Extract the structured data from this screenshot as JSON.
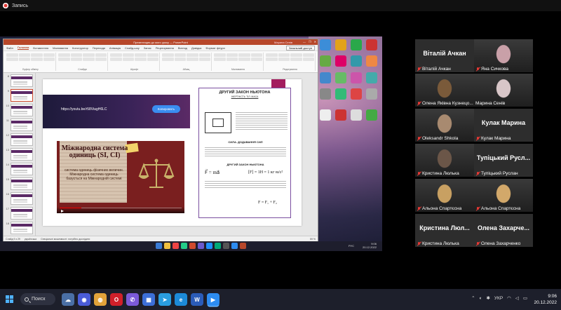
{
  "recording": {
    "label": "Запись",
    "color": "#e53935"
  },
  "powerpoint": {
    "window_title": "Презентация до мого уроку — PowerPoint",
    "user": "Марина Сенів",
    "window_controls": [
      "—",
      "❐",
      "✕"
    ],
    "tabs": [
      "Файл",
      "Головна",
      "Вставлення",
      "Малювання",
      "Конструктор",
      "Переходи",
      "Анімація",
      "Слайд-шоу",
      "Запис",
      "Рецензування",
      "Вигляд",
      "Довідка",
      "Формат фігури"
    ],
    "active_tab": "Головна",
    "share_button": "Загальний доступ",
    "ribbon_groups": [
      "Буфер обміну",
      "Слайди",
      "Шрифт",
      "Абзац",
      "Малювання",
      "Редагування"
    ],
    "slide_numbers": [
      "8",
      "9",
      "10",
      "11",
      "12",
      "13",
      "14",
      "15",
      "16",
      "17",
      "18",
      "19",
      "20"
    ],
    "active_slide": "9",
    "status": {
      "slide": "Слайд 9 з 29",
      "lang": "українська",
      "accessibility": "Спеціальні можливості: потрібно дослідити",
      "zoom": "59 %"
    }
  },
  "slide": {
    "url": "https://youtu.be/r58ViagH6LC",
    "copy_button": "Копировать",
    "video": {
      "title": "Міжнародна система одиниць (SI, СІ)",
      "text": "система одиниць фізичних величин. Міжнародна система одиниць базується на Міжнародній системі",
      "progress": 0.18
    },
    "doc": {
      "title": "ДРУГИЙ ЗАКОН НЬЮТОНА",
      "sub1": "ІНЕРТНІСТЬ ТІЛ. МАСА",
      "sub2": "СИЛА. ДОДАВАННЯ СИЛ",
      "sub3": "ДРУГИЙ ЗАКОН НЬЮТОНА",
      "formula_left": "F⃗ = ma⃗",
      "formula_right": "[F] = 1H = 1 кг·м/с²",
      "formula_bottom": "F = F₁ + F₂"
    }
  },
  "inner_taskbar": {
    "lang": "РУС",
    "time": "9:06",
    "date": "20.12.2022",
    "icon_colors": [
      "#3a7bd5",
      "#f0c040",
      "#e44",
      "#2c8",
      "#d04a2d",
      "#6a5acd",
      "#1e90ff",
      "#0a7",
      "#555",
      "#2d8cf0",
      "#b7472a"
    ]
  },
  "participants": [
    {
      "big_name": "Віталій Ачкан",
      "label": "Віталій Ачкан",
      "muted": true,
      "has_video": false
    },
    {
      "big_name": "",
      "label": "Яна Сичкова",
      "muted": true,
      "has_video": true,
      "face": "#c9a0a8"
    },
    {
      "big_name": "",
      "label": "Олена Яківна Кузнецо...",
      "muted": true,
      "has_video": true,
      "face": "#7a5a3a"
    },
    {
      "big_name": "",
      "label": "Марина Сенів",
      "muted": false,
      "has_video": true,
      "face": "#d8c6c8",
      "active": true
    },
    {
      "big_name": "",
      "label": "Oleksandr Shkola",
      "muted": true,
      "has_video": true,
      "face": "#a88a70"
    },
    {
      "big_name": "Кулак Марина",
      "label": "Кулак Марина",
      "muted": true,
      "has_video": false
    },
    {
      "big_name": "",
      "label": "Кристина Люлька",
      "muted": true,
      "has_video": true,
      "face": "#6b5648"
    },
    {
      "big_name": "Тупіцький Русл...",
      "label": "Тупіцький Руслан",
      "muted": true,
      "has_video": false
    },
    {
      "big_name": "",
      "label": "Альона Спартєсна",
      "muted": true,
      "has_video": true,
      "face": "#c8a062"
    },
    {
      "big_name": "",
      "label": "Альона Спартєсна",
      "muted": true,
      "has_video": true,
      "face": "#d2a86a"
    },
    {
      "big_name": "Кристина Люл...",
      "label": "Кристина Люлька",
      "muted": true,
      "has_video": false
    },
    {
      "big_name": "Олена Захарче...",
      "label": "Олена Захарченко",
      "muted": true,
      "has_video": false
    }
  ],
  "taskbar": {
    "search_label": "Поиск",
    "lang": "УКР",
    "time": "9:06",
    "date": "20.12.2022",
    "apps": [
      {
        "icon": "weather-icon",
        "color": "#4a6fa5",
        "glyph": "☁"
      },
      {
        "icon": "zoom-icon",
        "color": "#4a5cd8",
        "glyph": "◉"
      },
      {
        "icon": "chrome-icon",
        "color": "#e2a33a",
        "glyph": "◍"
      },
      {
        "icon": "opera-icon",
        "color": "#d0202a",
        "glyph": "O"
      },
      {
        "icon": "viber-icon",
        "color": "#7b5ad8",
        "glyph": "✆"
      },
      {
        "icon": "store-icon",
        "color": "#3c6fd8",
        "glyph": "▦"
      },
      {
        "icon": "telegram-icon",
        "color": "#2a9ddf",
        "glyph": "➤"
      },
      {
        "icon": "edge-icon",
        "color": "#1c8ad8",
        "glyph": "e"
      },
      {
        "icon": "word-icon",
        "color": "#2b5cb8",
        "glyph": "W"
      },
      {
        "icon": "zoom-app-icon",
        "color": "#2d8cf0",
        "glyph": "▶",
        "active": true
      }
    ]
  }
}
